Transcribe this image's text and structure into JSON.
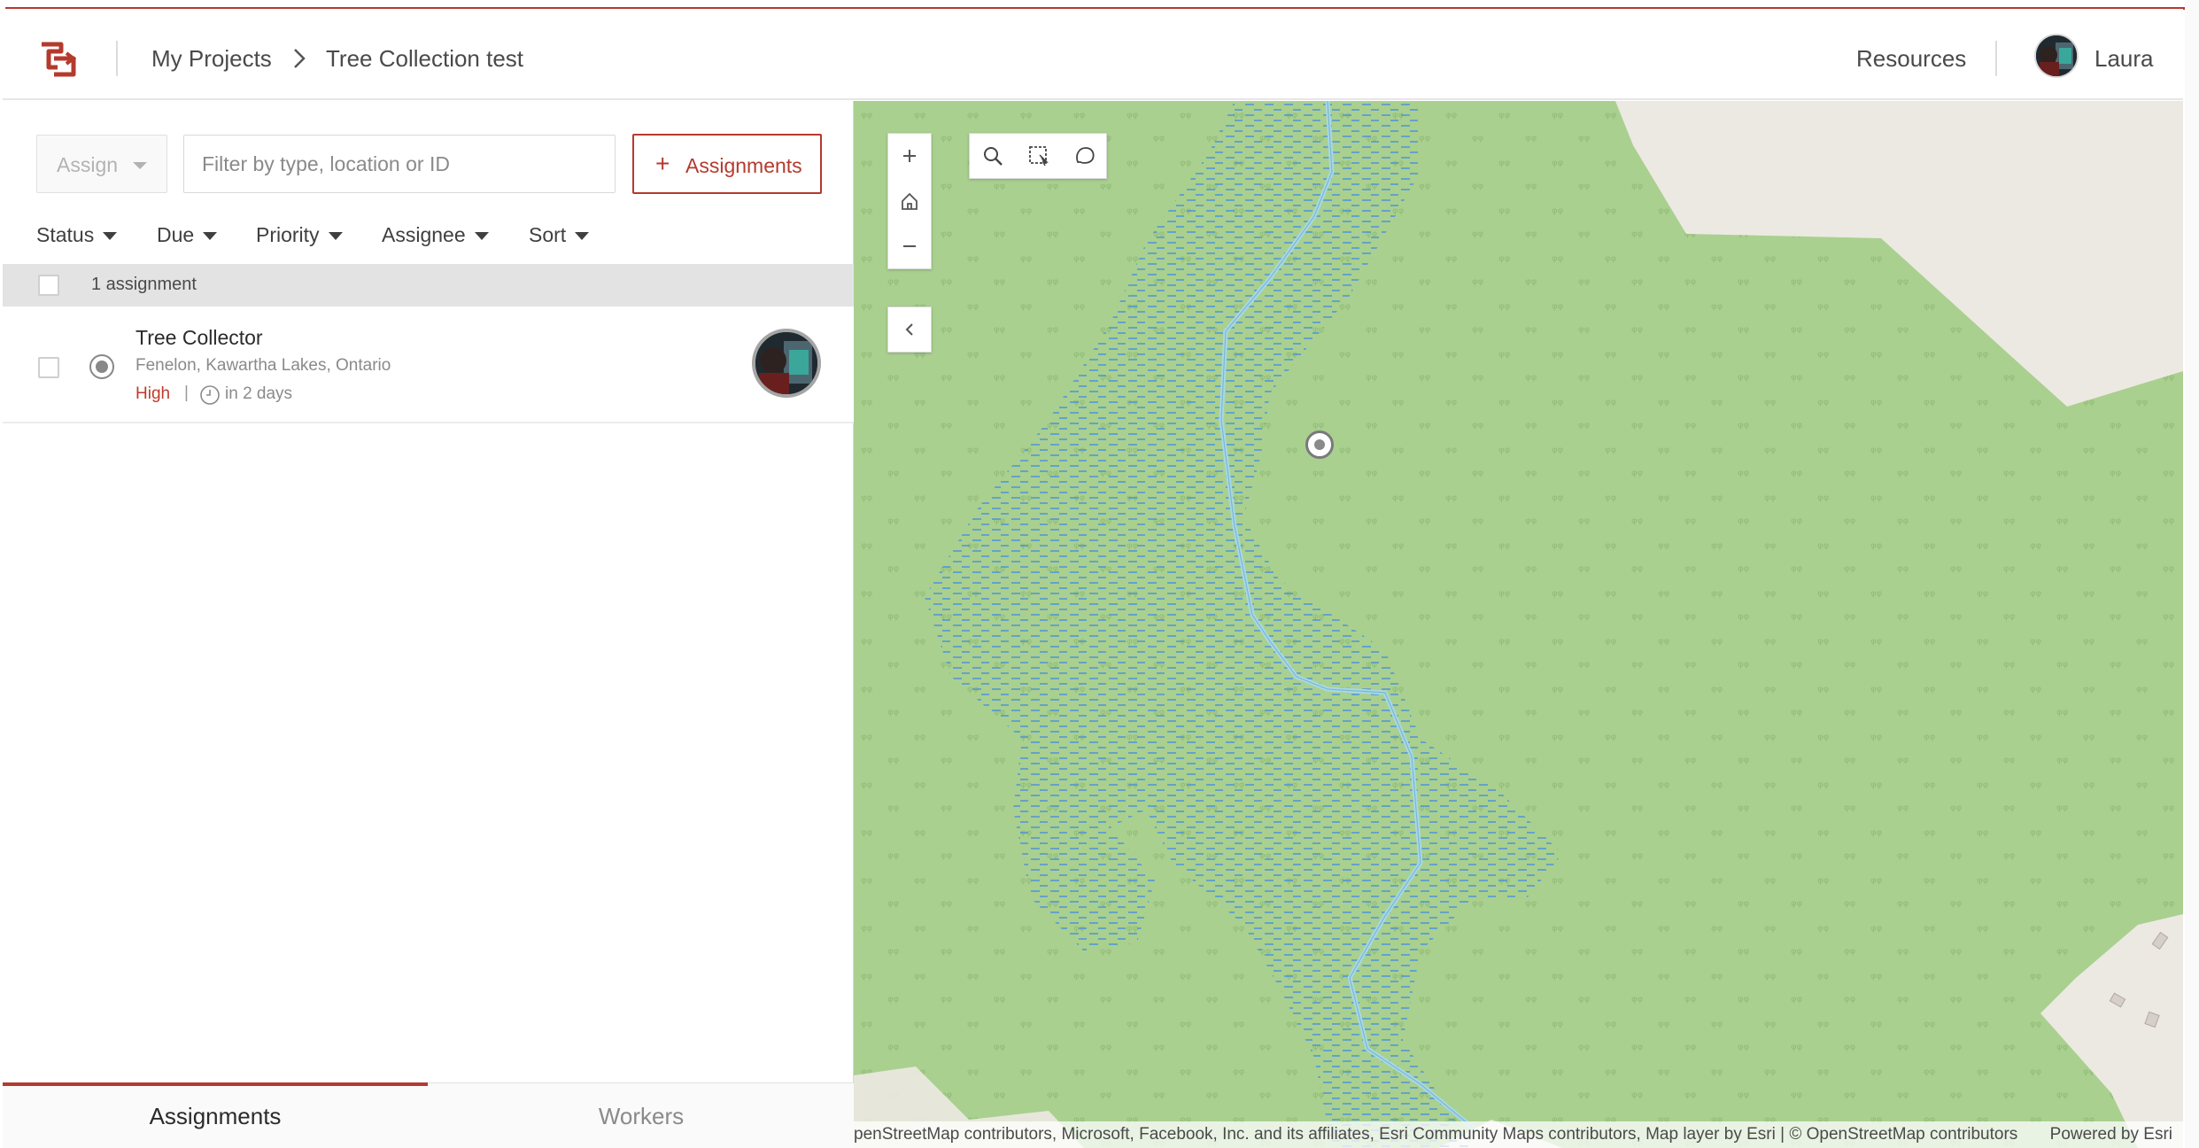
{
  "header": {
    "breadcrumb_root": "My Projects",
    "breadcrumb_current": "Tree Collection test",
    "resources_link": "Resources",
    "user_name": "Laura",
    "brand_color": "#b43a2e"
  },
  "toolbar": {
    "assign_label": "Assign",
    "filter_placeholder": "Filter by type, location or ID",
    "add_assignments_label": "Assignments",
    "sort_items": [
      "Status",
      "Due",
      "Priority",
      "Assignee",
      "Sort"
    ]
  },
  "list": {
    "count_label": "1 assignment",
    "items": [
      {
        "title": "Tree Collector",
        "location": "Fenelon, Kawartha Lakes, Ontario",
        "priority": "High",
        "due": "in 2 days"
      }
    ]
  },
  "tabs": {
    "assignments": "Assignments",
    "workers": "Workers"
  },
  "map": {
    "attribution": "penStreetMap contributors, Microsoft, Facebook, Inc. and its affiliates, Esri Community Maps contributors, Map layer by Esri | © OpenStreetMap contributors",
    "powered_by": "Powered by Esri",
    "icons": [
      "zoom-in-icon",
      "home-icon",
      "zoom-out-icon",
      "search-icon",
      "rectangle-select-icon",
      "lasso-select-icon",
      "chevron-left-icon"
    ],
    "colors": {
      "land": "#a9d08f",
      "urban": "#ece9e2",
      "water": "#4a8fe0",
      "stream": "#a8d8e8"
    }
  }
}
